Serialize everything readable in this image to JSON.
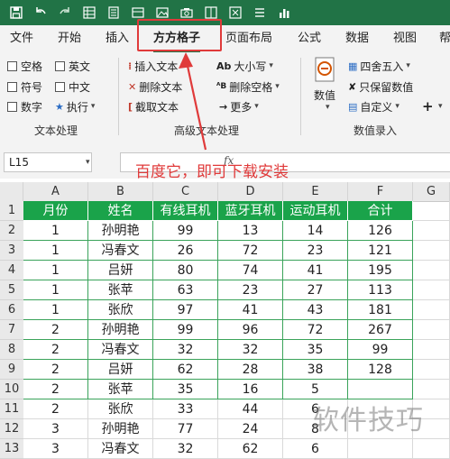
{
  "quick_access": {
    "icons": [
      "save-icon",
      "undo-icon",
      "redo-icon",
      "table-icon",
      "form-icon",
      "doc-icon",
      "picture-icon",
      "camera-icon",
      "sheet-icon",
      "formula-icon",
      "list-icon",
      "chart-icon"
    ]
  },
  "tabs": [
    "文件",
    "开始",
    "插入",
    "方方格子",
    "页面布局",
    "公式",
    "数据",
    "视图",
    "帮"
  ],
  "active_tab": "方方格子",
  "ribbon": {
    "text_processing": {
      "checkboxes": [
        "空格",
        "英文",
        "符号",
        "中文",
        "数字"
      ],
      "execute": "执行",
      "label": "文本处理"
    },
    "advanced_text": {
      "insert_text": "插入文本",
      "delete_text": "删除文本",
      "extract_text": "截取文本",
      "case": "大小写",
      "delete_space": "删除空格",
      "more": "更多",
      "label": "高级文本处理"
    },
    "numeric": {
      "value": "数值",
      "round": "四舍五入",
      "keep_value": "只保留数值",
      "custom": "自定义",
      "label": "数值录入"
    }
  },
  "formula_bar": {
    "name_box": "L15",
    "fx": "fx"
  },
  "annotation": "百度它，即可下载安装",
  "grid": {
    "columns": [
      "A",
      "B",
      "C",
      "D",
      "E",
      "F",
      "G"
    ],
    "row_numbers": [
      "1",
      "2",
      "3",
      "4",
      "5",
      "6",
      "7",
      "8",
      "9",
      "10",
      "11",
      "12",
      "13"
    ],
    "header": [
      "月份",
      "姓名",
      "有线耳机",
      "蓝牙耳机",
      "运动耳机",
      "合计"
    ],
    "rows": [
      [
        "1",
        "孙明艳",
        "99",
        "13",
        "14",
        "126"
      ],
      [
        "1",
        "冯春文",
        "26",
        "72",
        "23",
        "121"
      ],
      [
        "1",
        "吕妍",
        "80",
        "74",
        "41",
        "195"
      ],
      [
        "1",
        "张苹",
        "63",
        "23",
        "27",
        "113"
      ],
      [
        "1",
        "张欣",
        "97",
        "41",
        "43",
        "181"
      ],
      [
        "2",
        "孙明艳",
        "99",
        "96",
        "72",
        "267"
      ],
      [
        "2",
        "冯春文",
        "32",
        "32",
        "35",
        "99"
      ],
      [
        "2",
        "吕妍",
        "62",
        "28",
        "38",
        "128"
      ],
      [
        "2",
        "张苹",
        "35",
        "16",
        "5",
        ""
      ],
      [
        "2",
        "张欣",
        "33",
        "44",
        "6",
        ""
      ],
      [
        "3",
        "孙明艳",
        "77",
        "24",
        "8",
        ""
      ],
      [
        "3",
        "冯春文",
        "32",
        "62",
        "6",
        ""
      ]
    ]
  },
  "watermark": "软件技巧",
  "colors": {
    "title_bar": "#217346",
    "header_fill": "#1aa34a",
    "annotation_red": "#e03a3a"
  }
}
